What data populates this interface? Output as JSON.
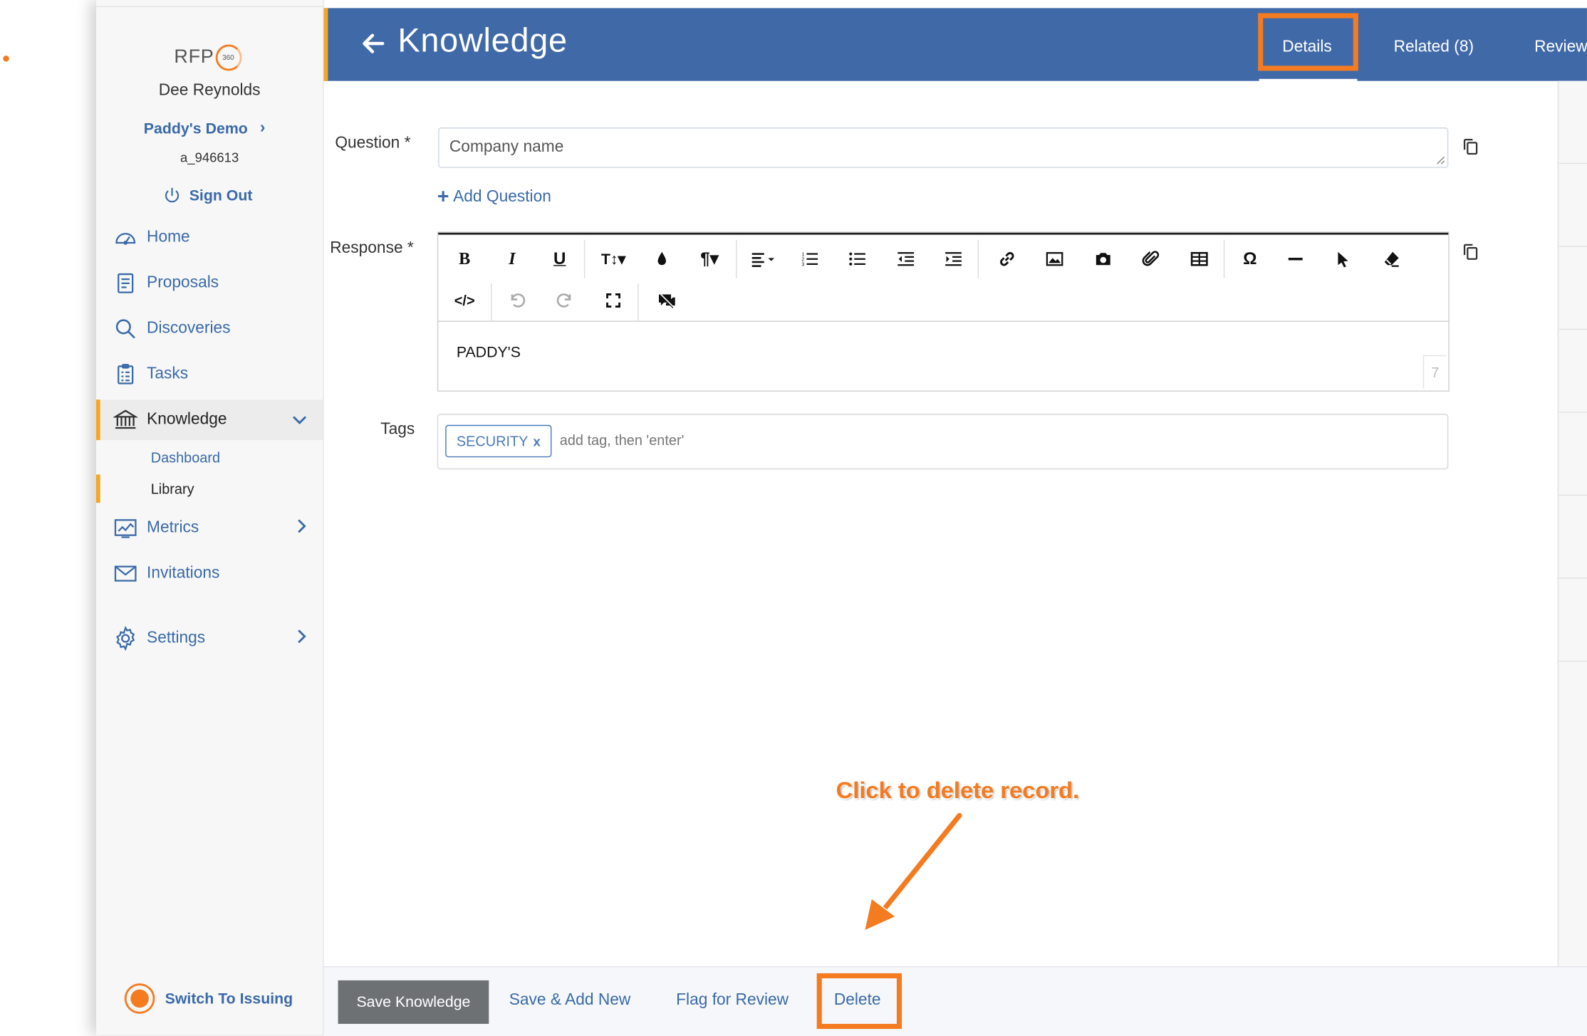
{
  "app": {
    "logo_text": "RFP",
    "logo_badge": "360",
    "user_name": "Dee Reynolds",
    "account_name": "Paddy's Demo",
    "account_id": "a_946613",
    "sign_out": "Sign Out",
    "switch_label": "Switch To Issuing"
  },
  "sidebar": {
    "items": [
      {
        "label": "Home",
        "icon": "dashboard-gauge-icon"
      },
      {
        "label": "Proposals",
        "icon": "document-icon"
      },
      {
        "label": "Discoveries",
        "icon": "search-icon"
      },
      {
        "label": "Tasks",
        "icon": "clipboard-icon"
      },
      {
        "label": "Knowledge",
        "icon": "library-building-icon",
        "expanded": true
      },
      {
        "label": "Metrics",
        "icon": "chart-icon"
      },
      {
        "label": "Invitations",
        "icon": "envelope-icon"
      },
      {
        "label": "Settings",
        "icon": "gear-icon"
      }
    ],
    "knowledge_sub": [
      "Dashboard",
      "Library"
    ]
  },
  "header": {
    "title": "Knowledge",
    "tabs": [
      "Details",
      "Related (8)",
      "Review"
    ],
    "active_tab": "Details"
  },
  "form": {
    "question_label": "Question *",
    "question_value": "Company name",
    "add_question": "Add Question",
    "response_label": "Response *",
    "response_value": "PADDY'S",
    "response_counter": "7",
    "tags_label": "Tags",
    "tags": [
      "SECURITY"
    ],
    "tag_remove": "x",
    "tags_placeholder": "add tag, then 'enter'"
  },
  "toolbar_row1": [
    "bold",
    "italic",
    "underline",
    "font-size",
    "color",
    "paragraph",
    "align",
    "ordered-list",
    "unordered-list",
    "outdent",
    "indent",
    "link",
    "image",
    "camera",
    "attachment",
    "table",
    "special-char",
    "horizontal-rule",
    "select",
    "clear-format"
  ],
  "toolbar_row2": [
    "code-view",
    "undo",
    "redo",
    "fullscreen",
    "comment"
  ],
  "annotation": {
    "text": "Click to delete record."
  },
  "footer": {
    "save": "Save Knowledge",
    "save_add": "Save & Add New",
    "flag": "Flag for Review",
    "delete": "Delete"
  },
  "colors": {
    "header": "#4069a8",
    "accent": "#f5a623",
    "highlight": "#f47b20",
    "link": "#3a6aa8"
  }
}
